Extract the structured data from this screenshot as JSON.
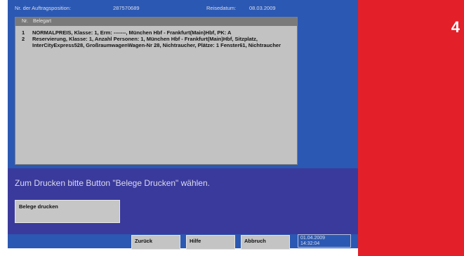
{
  "header": {
    "order_position_label": "Nr. der Auftragsposition:",
    "order_position_value": "287570689",
    "travel_date_label": "Reisedatum:",
    "travel_date_value": "08.03.2009"
  },
  "list": {
    "columns": {
      "nr": "Nr.",
      "type": "Belegart"
    },
    "rows": [
      {
        "nr": "1",
        "text": "NORMALPREIS, Klasse: 1, Erm: -------, München Hbf - Frankfurt(Main)Hbf, PK: A"
      },
      {
        "nr": "2",
        "text": "Reservierung, Klasse: 1, Anzahl Personen: 1, München Hbf - Frankfurt(Main)Hbf, Sitzplatz, InterCityExpress528, GroßraumwagenWagen-Nr 28, Nichtraucher, Plätze: 1 Fenster61, Nichtraucher"
      }
    ]
  },
  "instruction": "Zum Drucken bitte Button \"Belege Drucken\" wählen.",
  "buttons": {
    "print": "Belege drucken",
    "back": "Zurück",
    "help": "Hilfe",
    "cancel": "Abbruch"
  },
  "status": {
    "date": "01.04.2009",
    "time": "14:32:04"
  },
  "step": {
    "number": "4"
  },
  "colors": {
    "screen": "#2b58b2",
    "instruction_bar": "#3a3a9c",
    "brand_red": "#e3202a",
    "button": "#c4c4c4"
  }
}
